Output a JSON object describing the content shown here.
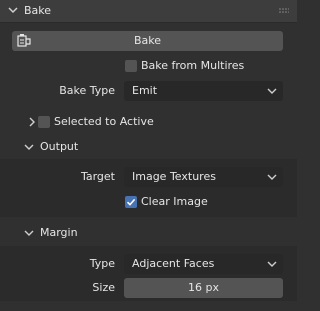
{
  "panel": {
    "title": "Bake",
    "bake_button_label": "Bake",
    "bake_from_multires_label": "Bake from Multires",
    "bake_type": {
      "label": "Bake Type",
      "value": "Emit"
    },
    "selected_to_active_label": "Selected to Active",
    "output": {
      "title": "Output",
      "target": {
        "label": "Target",
        "value": "Image Textures"
      },
      "clear_image_label": "Clear Image"
    },
    "margin": {
      "title": "Margin",
      "type": {
        "label": "Type",
        "value": "Adjacent Faces"
      },
      "size": {
        "label": "Size",
        "value": "16 px"
      }
    }
  }
}
